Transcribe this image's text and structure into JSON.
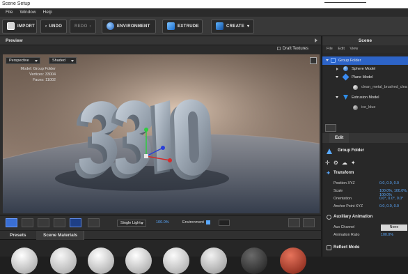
{
  "window": {
    "title": "Scene Setup"
  },
  "menubar": [
    "File",
    "Window",
    "Help"
  ],
  "toolbar": {
    "import": "IMPORT",
    "undo": "UNDO",
    "redo": "REDO",
    "environment": "ENVIRONMENT",
    "extrude": "EXTRUDE",
    "create": "CREATE"
  },
  "preview": {
    "title": "Preview",
    "draft_textures": "Draft Textures",
    "camera_mode": "Perspective",
    "shading_mode": "Shaded",
    "info": {
      "model_label": "Model:",
      "model_value": "Group Folder",
      "vertices_label": "Vertices:",
      "vertices_value": "33004",
      "faces_label": "Faces:",
      "faces_value": "11002"
    },
    "scene_text": "3310",
    "bottom": {
      "light": "Single Light",
      "light_pct": "100.0%",
      "environment_label": "Environment"
    }
  },
  "bottom_panel": {
    "tabs": [
      "Presets",
      "Scene Materials"
    ]
  },
  "scene_panel": {
    "title": "Scene",
    "menu": [
      "File",
      "Edit",
      "View"
    ],
    "tree": [
      {
        "label": "Group Folder",
        "level": 0,
        "selected": true
      },
      {
        "label": "Sphere Model",
        "level": 1,
        "selected": false
      },
      {
        "label": "Plane Model",
        "level": 1,
        "selected": false
      },
      {
        "label": "clean_metal_brushed_clea",
        "level": 2,
        "selected": false
      },
      {
        "label": "Extrusion Model",
        "level": 1,
        "selected": false
      },
      {
        "label": "ice_blue",
        "level": 2,
        "selected": false
      }
    ]
  },
  "edit_panel": {
    "tab": "Edit",
    "object_name": "Group Folder",
    "transform_title": "Transform",
    "properties": [
      {
        "label": "Position XYZ",
        "value": "0.0, 0.0, 0.0"
      },
      {
        "label": "Scale",
        "value": "100.0%, 100.0%, 100.0%"
      },
      {
        "label": "Orientation",
        "value": "0.0°, 0.0°, 0.0°"
      },
      {
        "label": "Anchor Point XYZ",
        "value": "0.0, 0.0, 0.0"
      }
    ],
    "aux_title": "Auxiliary Animation",
    "aux_channel_label": "Aux Channel",
    "aux_channel_value": "None",
    "anim_ratio_label": "Animation Ratio",
    "anim_ratio_value": "100.0%",
    "reflect_title": "Reflect Mode"
  }
}
